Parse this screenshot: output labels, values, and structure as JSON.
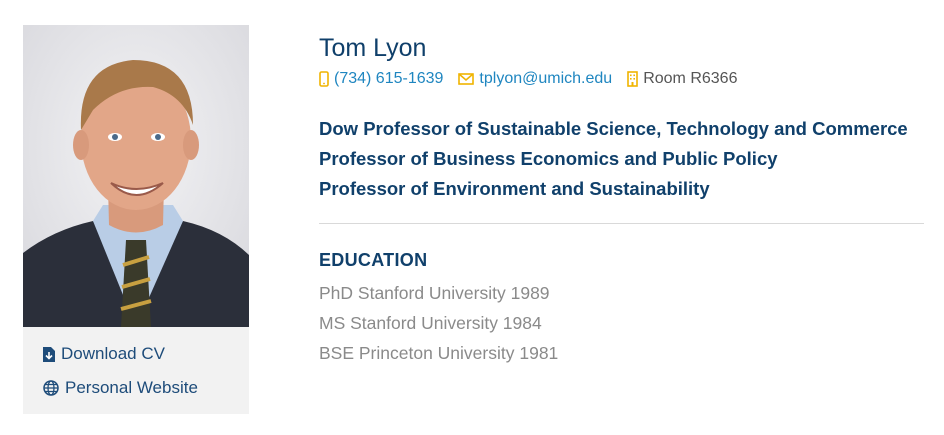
{
  "profile": {
    "name": "Tom Lyon",
    "phone": "(734) 615-1639",
    "email": "tplyon@umich.edu",
    "room": "Room R6366"
  },
  "titles": [
    "Dow Professor of Sustainable Science, Technology and Commerce",
    "Professor of Business Economics and Public Policy",
    "Professor of Environment and Sustainability"
  ],
  "education": {
    "heading": "EDUCATION",
    "items": [
      "PhD Stanford University 1989",
      "MS Stanford University 1984",
      "BSE Princeton University 1981"
    ]
  },
  "sidebar": {
    "download_cv": "Download CV",
    "personal_website": "Personal Website"
  },
  "colors": {
    "navy": "#10406b",
    "link_blue": "#1f86c0",
    "icon_gold": "#f0b400",
    "gray_text": "#8a8a8a"
  },
  "icons": [
    "phone-icon",
    "envelope-icon",
    "building-icon",
    "file-download-icon",
    "globe-icon"
  ]
}
